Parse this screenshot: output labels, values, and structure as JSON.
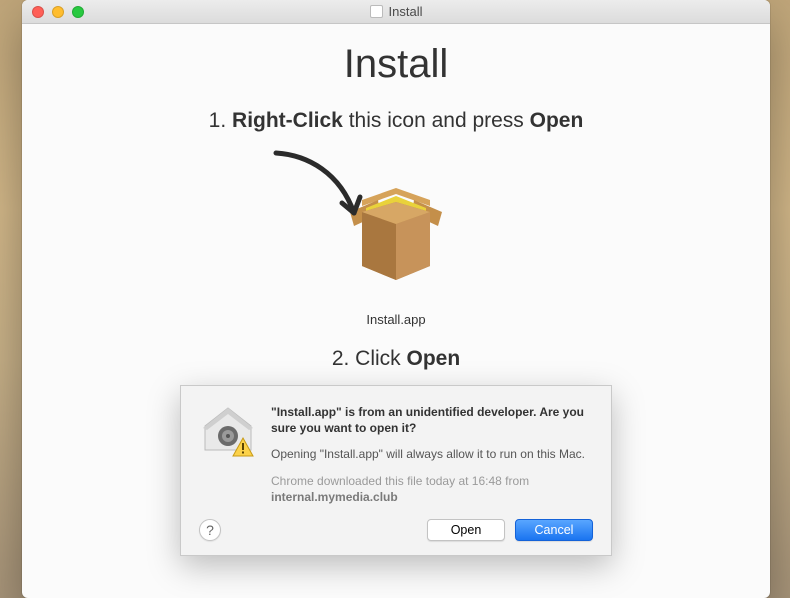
{
  "window": {
    "title": "Install"
  },
  "main": {
    "heading": "Install",
    "step1_prefix": "1. ",
    "step1_bold1": "Right-Click",
    "step1_mid": " this icon and press ",
    "step1_bold2": "Open",
    "app_icon_name": "Install.app",
    "step2_prefix": "2. Click ",
    "step2_bold": "Open"
  },
  "dialog": {
    "message": "\"Install.app\" is from an unidentified developer. Are you sure you want to open it?",
    "subtext": "Opening \"Install.app\" will always allow it to run on this Mac.",
    "meta_prefix": "Chrome downloaded this file today at 16:48 from ",
    "meta_domain": "internal.mymedia.club",
    "help_label": "?",
    "open_label": "Open",
    "cancel_label": "Cancel"
  },
  "colors": {
    "primary_button": "#1a74f0"
  }
}
